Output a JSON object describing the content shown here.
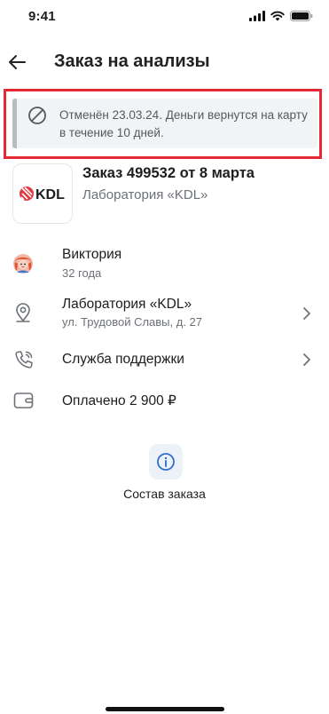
{
  "status_bar": {
    "time": "9:41"
  },
  "header": {
    "title": "Заказ на анализы"
  },
  "banner": {
    "text": "Отменён 23.03.24. Деньги вернутся на карту в течение 10 дней.",
    "accent": "#e52a35"
  },
  "order": {
    "logo_text": "KDL",
    "title": "Заказ 499532 от 8 марта",
    "lab": "Лаборатория «KDL»"
  },
  "patient": {
    "name": "Виктория",
    "age": "32 года"
  },
  "location": {
    "title": "Лаборатория «KDL»",
    "address": "ул. Трудовой Славы, д. 27"
  },
  "support": {
    "label": "Служба поддержки"
  },
  "payment": {
    "label": "Оплачено 2 900 ₽"
  },
  "composition": {
    "label": "Состав заказа"
  }
}
